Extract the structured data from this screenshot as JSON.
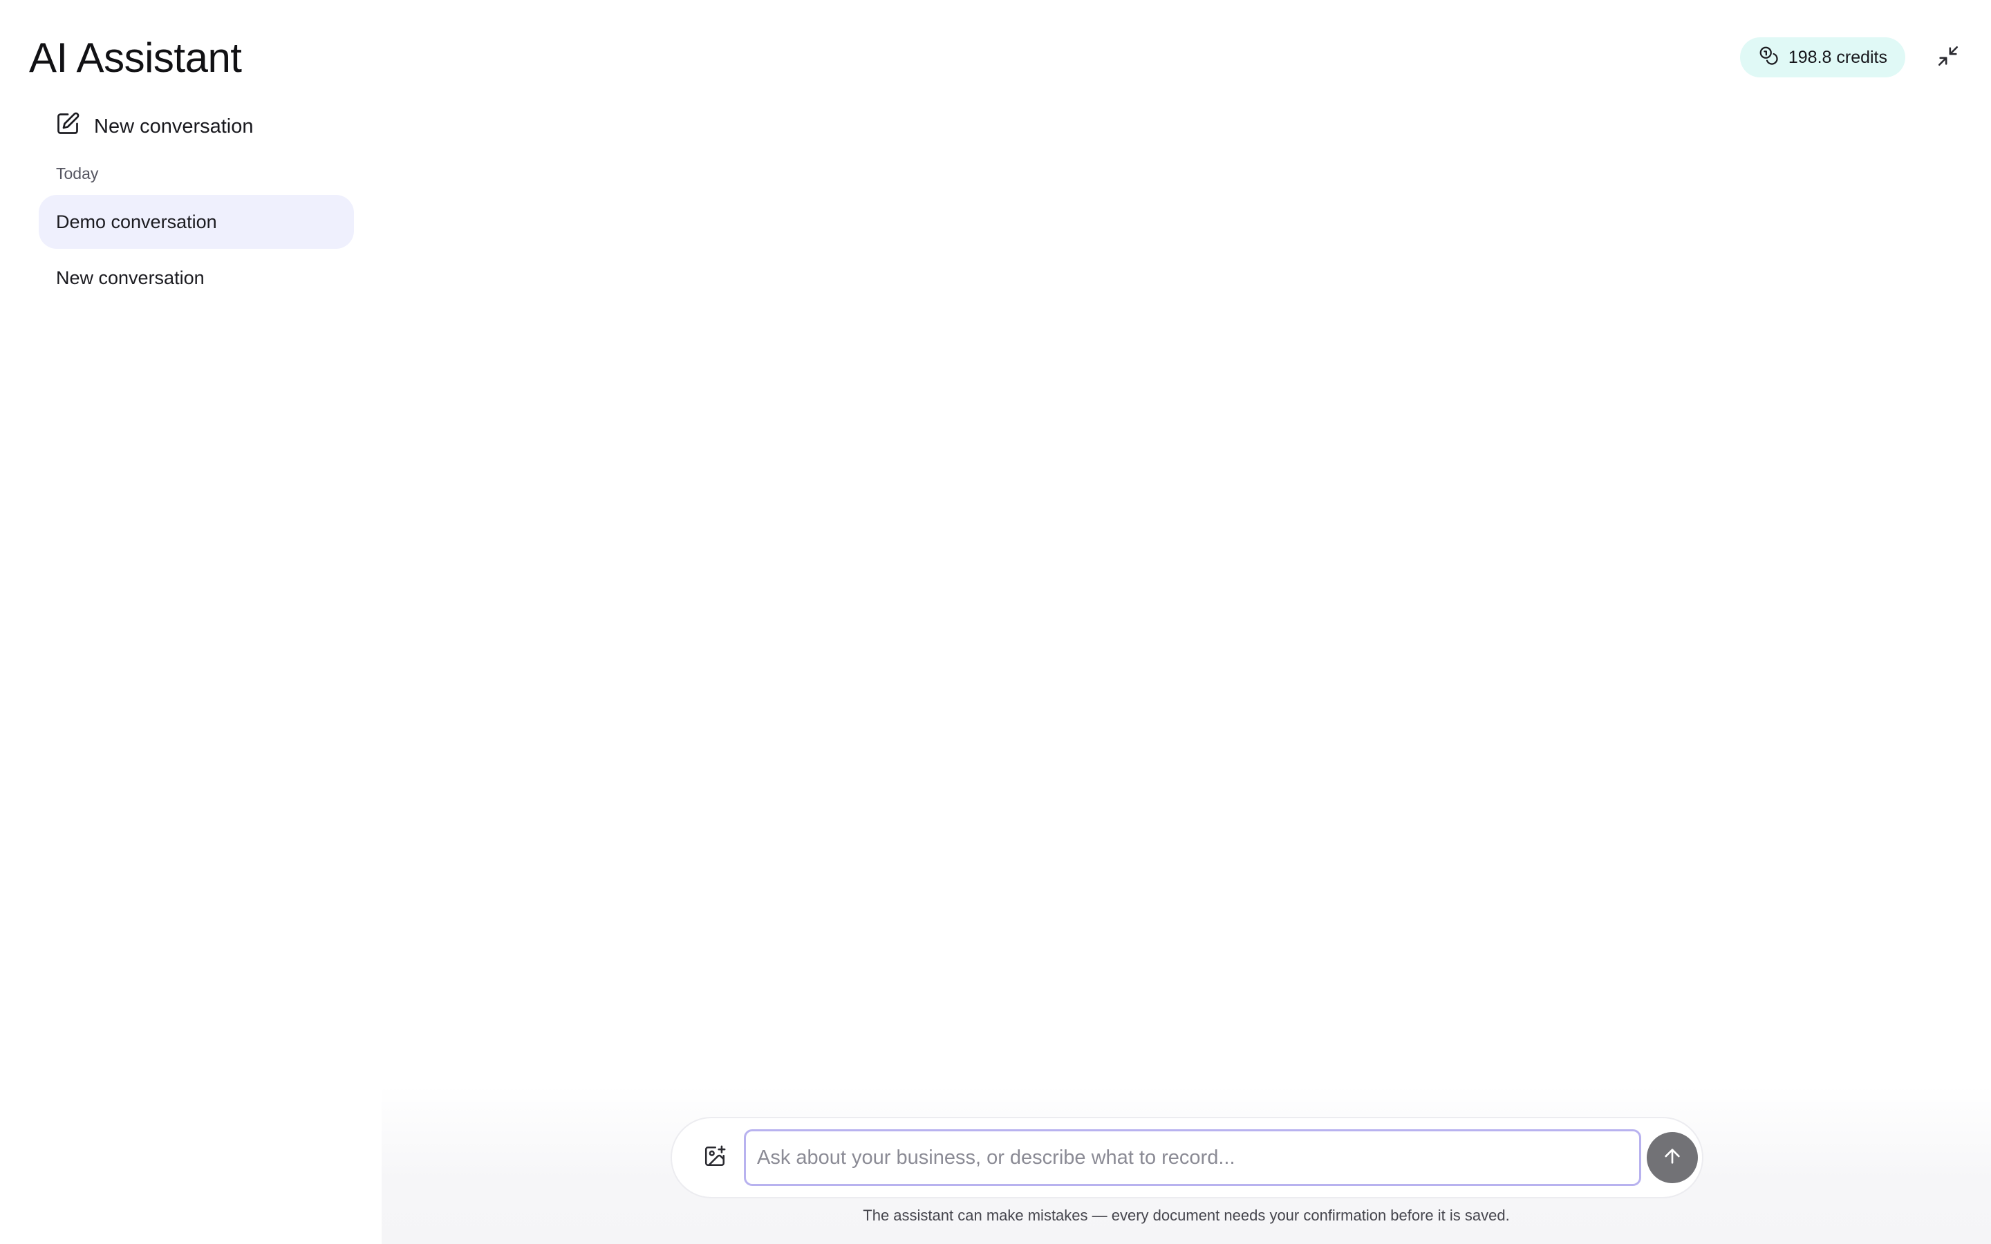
{
  "app": {
    "title": "AI Assistant"
  },
  "header": {
    "credits_label": "198.8 credits",
    "credits_icon": "coins-icon",
    "collapse_icon": "minimize-icon"
  },
  "sidebar": {
    "new_conversation_label": "New conversation",
    "new_conversation_icon": "edit-icon",
    "section_label": "Today",
    "conversations": [
      {
        "label": "Demo conversation",
        "active": true
      },
      {
        "label": "New conversation",
        "active": false
      }
    ]
  },
  "composer": {
    "placeholder": "Ask about your business, or describe what to record...",
    "value": "",
    "attach_icon": "image-add-icon",
    "send_icon": "arrow-up-icon"
  },
  "footer": {
    "disclaimer": "The assistant can make mistakes — every document needs your confirmation before it is saved."
  },
  "colors": {
    "credits_badge_bg": "#e0f9f6",
    "active_item_bg": "#eff0fd",
    "input_border": "#b8b2ef",
    "send_button_bg": "#727276"
  }
}
